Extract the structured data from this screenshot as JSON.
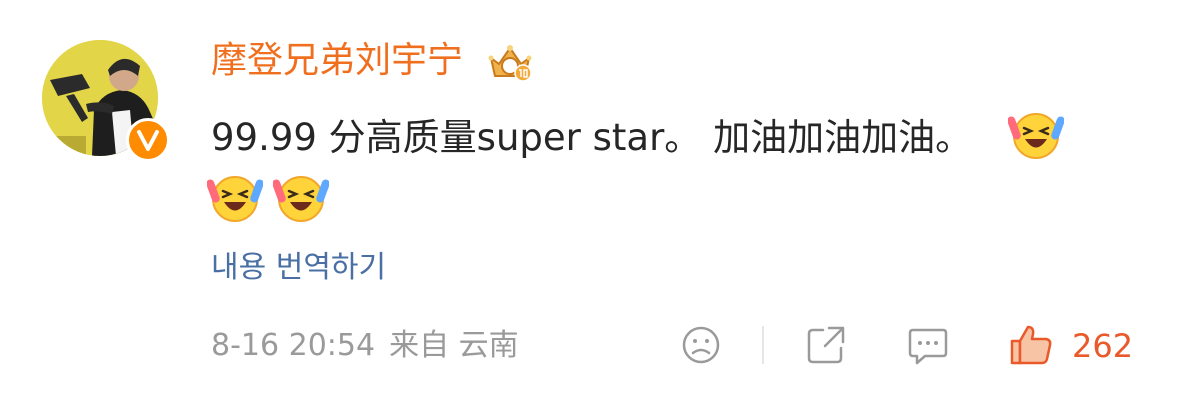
{
  "comment": {
    "username": "摩登兄弟刘宇宁",
    "verified_badge": "V",
    "text_line1": "99.99 分高质量super star。 加油加油加油。",
    "translate_link": "내용 번역하기",
    "date": "8-16 20:54",
    "source": "来自 云南",
    "like_count": "262",
    "icons": [
      "avatar",
      "verified-icon",
      "crown-badge-icon",
      "laughing-emoji-icon",
      "sad-face-icon",
      "share-icon",
      "comment-icon",
      "thumbs-up-icon"
    ]
  },
  "colors": {
    "username": "#f06f1f",
    "text": "#262626",
    "link": "#4a6fa5",
    "meta": "#9a9a9a",
    "like": "#e9592a"
  }
}
